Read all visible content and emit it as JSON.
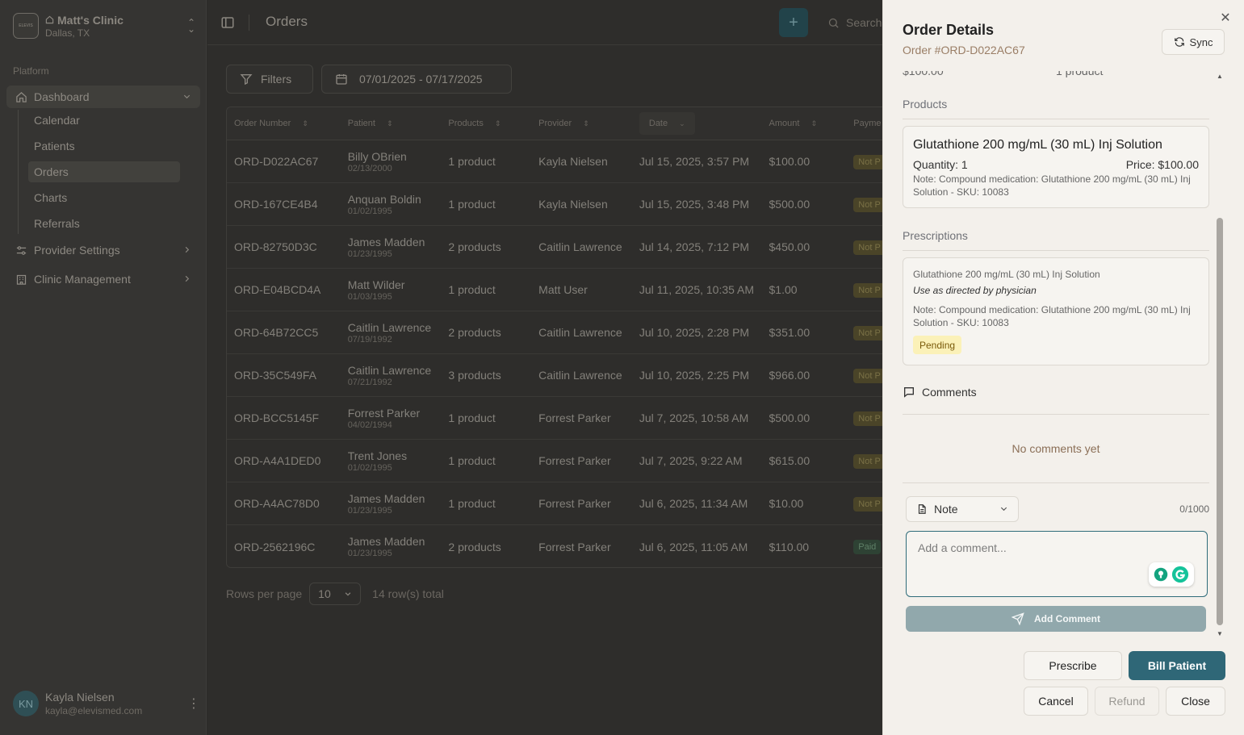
{
  "sidebar": {
    "clinic_logo_text": "ELEVIS",
    "clinic_name": "Matt's Clinic",
    "clinic_location": "Dallas, TX",
    "section_label": "Platform",
    "nav": {
      "dashboard": "Dashboard",
      "sub": [
        "Calendar",
        "Patients",
        "Orders",
        "Charts",
        "Referrals"
      ],
      "provider_settings": "Provider Settings",
      "clinic_management": "Clinic Management"
    },
    "user": {
      "initials": "KN",
      "name": "Kayla Nielsen",
      "email": "kayla@elevismed.com"
    }
  },
  "header": {
    "title": "Orders",
    "add_label": "+",
    "search_placeholder": "Search"
  },
  "toolbar": {
    "filters_label": "Filters",
    "date_range": "07/01/2025 - 07/17/2025"
  },
  "table": {
    "columns": [
      "Order Number",
      "Patient",
      "Products",
      "Provider",
      "Date",
      "Amount",
      "Payme"
    ],
    "rows": [
      {
        "order": "ORD-D022AC67",
        "patient": "Billy OBrien",
        "dob": "02/13/2000",
        "products": "1 product",
        "provider": "Kayla Nielsen",
        "date": "Jul 15, 2025, 3:57 PM",
        "amount": "$100.00",
        "payment": "Not P"
      },
      {
        "order": "ORD-167CE4B4",
        "patient": "Anquan Boldin",
        "dob": "01/02/1995",
        "products": "1 product",
        "provider": "Kayla Nielsen",
        "date": "Jul 15, 2025, 3:48 PM",
        "amount": "$500.00",
        "payment": "Not P"
      },
      {
        "order": "ORD-82750D3C",
        "patient": "James Madden",
        "dob": "01/23/1995",
        "products": "2 products",
        "provider": "Caitlin Lawrence",
        "date": "Jul 14, 2025, 7:12 PM",
        "amount": "$450.00",
        "payment": "Not P"
      },
      {
        "order": "ORD-E04BCD4A",
        "patient": "Matt Wilder",
        "dob": "01/03/1995",
        "products": "1 product",
        "provider": "Matt User",
        "date": "Jul 11, 2025, 10:35 AM",
        "amount": "$1.00",
        "payment": "Not P"
      },
      {
        "order": "ORD-64B72CC5",
        "patient": "Caitlin Lawrence",
        "dob": "07/19/1992",
        "products": "2 products",
        "provider": "Caitlin Lawrence",
        "date": "Jul 10, 2025, 2:28 PM",
        "amount": "$351.00",
        "payment": "Not P"
      },
      {
        "order": "ORD-35C549FA",
        "patient": "Caitlin Lawrence",
        "dob": "07/21/1992",
        "products": "3 products",
        "provider": "Caitlin Lawrence",
        "date": "Jul 10, 2025, 2:25 PM",
        "amount": "$966.00",
        "payment": "Not P"
      },
      {
        "order": "ORD-BCC5145F",
        "patient": "Forrest Parker",
        "dob": "04/02/1994",
        "products": "1 product",
        "provider": "Forrest Parker",
        "date": "Jul 7, 2025, 10:58 AM",
        "amount": "$500.00",
        "payment": "Not P"
      },
      {
        "order": "ORD-A4A1DED0",
        "patient": "Trent Jones",
        "dob": "01/02/1995",
        "products": "1 product",
        "provider": "Forrest Parker",
        "date": "Jul 7, 2025, 9:22 AM",
        "amount": "$615.00",
        "payment": "Not P"
      },
      {
        "order": "ORD-A4AC78D0",
        "patient": "James Madden",
        "dob": "01/23/1995",
        "products": "1 product",
        "provider": "Forrest Parker",
        "date": "Jul 6, 2025, 11:34 AM",
        "amount": "$10.00",
        "payment": "Not P"
      },
      {
        "order": "ORD-2562196C",
        "patient": "James Madden",
        "dob": "01/23/1995",
        "products": "2 products",
        "provider": "Forrest Parker",
        "date": "Jul 6, 2025, 11:05 AM",
        "amount": "$110.00",
        "payment": "Paid"
      }
    ]
  },
  "pager": {
    "rows_per_page_label": "Rows per page",
    "rows_per_page_value": "10",
    "total": "14 row(s) total"
  },
  "drawer": {
    "title": "Order Details",
    "subtitle": "Order #ORD-D022AC67",
    "sync_label": "Sync",
    "clipped_amount": "$100.00",
    "clipped_products": "1 product",
    "products_heading": "Products",
    "product": {
      "name": "Glutathione 200 mg/mL (30 mL) Inj Solution",
      "quantity": "Quantity: 1",
      "price": "Price: $100.00",
      "note": "Note: Compound medication: Glutathione 200 mg/mL (30 mL) Inj Solution - SKU: 10083"
    },
    "prescriptions_heading": "Prescriptions",
    "prescription": {
      "name": "Glutathione 200 mg/mL (30 mL) Inj Solution",
      "directions": "Use as directed by physician",
      "note": "Note: Compound medication: Glutathione 200 mg/mL (30 mL) Inj Solution - SKU: 10083",
      "status": "Pending"
    },
    "comments_heading": "Comments",
    "no_comments": "No comments yet",
    "comment_type": "Note",
    "counter": "0/1000",
    "comment_placeholder": "Add a comment...",
    "add_comment_label": "Add Comment",
    "prescribe_label": "Prescribe",
    "bill_label": "Bill Patient",
    "cancel_label": "Cancel",
    "refund_label": "Refund",
    "close_label": "Close"
  }
}
